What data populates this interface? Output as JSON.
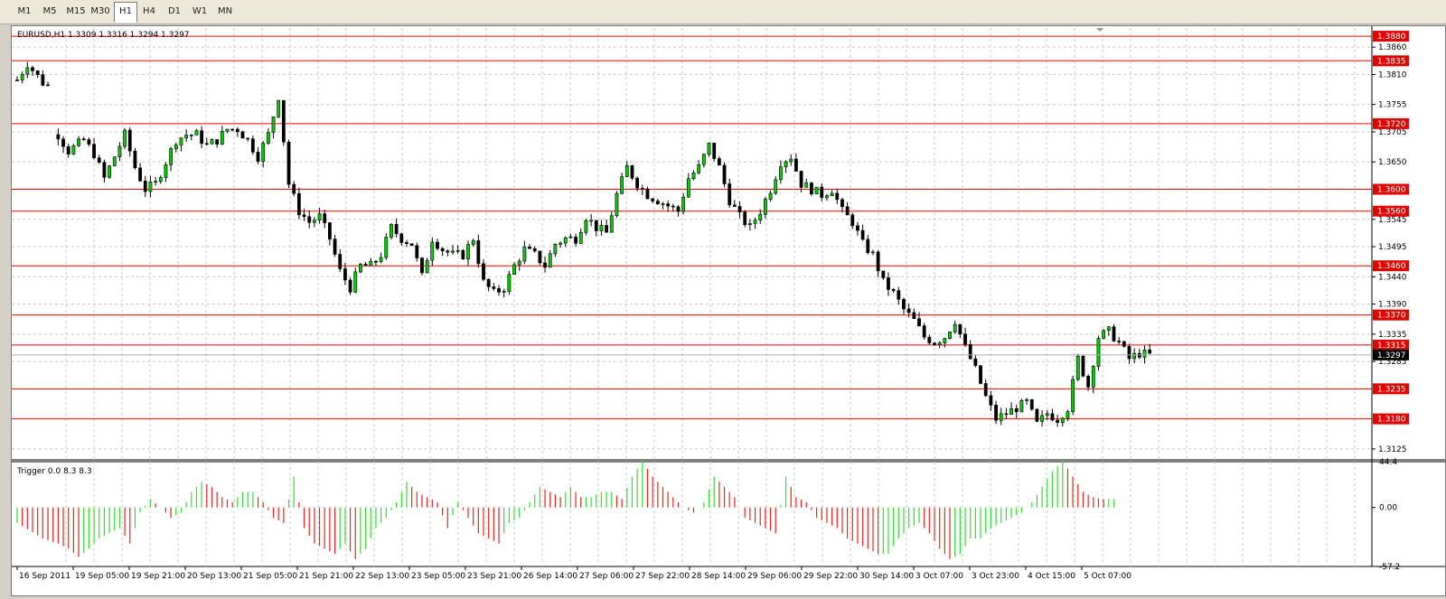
{
  "timeframes": [
    {
      "label": "M1",
      "active": false
    },
    {
      "label": "M5",
      "active": false
    },
    {
      "label": "M15",
      "active": false
    },
    {
      "label": "M30",
      "active": false
    },
    {
      "label": "H1",
      "active": true
    },
    {
      "label": "H4",
      "active": false
    },
    {
      "label": "D1",
      "active": false
    },
    {
      "label": "W1",
      "active": false
    },
    {
      "label": "MN",
      "active": false
    }
  ],
  "chart_header": "EURUSD,H1  1.3309 1.3316 1.3294 1.3297",
  "indicator_header": "Trigger 0.0 8.3 8.3",
  "colors": {
    "line": "#ff0000",
    "candle_bull": "#00cc00",
    "candle_bear": "#000000",
    "hist_pos": "#33dd33",
    "hist_neg": "#ee2222",
    "grid": "#c8c8c8",
    "price_tag_bg": "#e00000",
    "current_tag_bg": "#000000"
  },
  "chart_data": [
    {
      "type": "candlestick",
      "symbol": "EURUSD",
      "timeframe": "H1",
      "ohlc_last": {
        "open": 1.3309,
        "high": 1.3316,
        "low": 1.3294,
        "close": 1.3297
      },
      "y_ticks": [
        "1.3860",
        "1.3810",
        "1.3755",
        "1.3705",
        "1.3650",
        "1.3545",
        "1.3495",
        "1.3440",
        "1.3390",
        "1.3335",
        "1.3285",
        "1.3125"
      ],
      "ylim": [
        1.3105,
        1.3895
      ],
      "horizontal_levels": [
        "1.3880",
        "1.3835",
        "1.3720",
        "1.3600",
        "1.3560",
        "1.3460",
        "1.3370",
        "1.3315",
        "1.3235",
        "1.3180"
      ],
      "current_price": "1.3297",
      "x_labels": [
        "16 Sep 2011",
        "19 Sep 05:00",
        "19 Sep 21:00",
        "20 Sep 13:00",
        "21 Sep 05:00",
        "21 Sep 21:00",
        "22 Sep 13:00",
        "23 Sep 05:00",
        "23 Sep 21:00",
        "26 Sep 14:00",
        "27 Sep 06:00",
        "27 Sep 22:00",
        "28 Sep 14:00",
        "29 Sep 06:00",
        "29 Sep 22:00",
        "30 Sep 14:00",
        "3 Oct 07:00",
        "3 Oct 23:00",
        "4 Oct 15:00",
        "5 Oct 07:00"
      ],
      "close_path": [
        [
          0,
          1.38
        ],
        [
          2,
          1.383
        ],
        [
          5,
          1.3795
        ],
        [
          6,
          1.379
        ],
        [
          8,
          1.37
        ],
        [
          10,
          1.367
        ],
        [
          13,
          1.369
        ],
        [
          15,
          1.3665
        ],
        [
          17,
          1.362
        ],
        [
          19,
          1.366
        ],
        [
          21,
          1.37
        ],
        [
          23,
          1.364
        ],
        [
          25,
          1.36
        ],
        [
          27,
          1.361
        ],
        [
          29,
          1.365
        ],
        [
          31,
          1.369
        ],
        [
          33,
          1.37
        ],
        [
          35,
          1.37
        ],
        [
          37,
          1.368
        ],
        [
          39,
          1.369
        ],
        [
          41,
          1.371
        ],
        [
          43,
          1.371
        ],
        [
          45,
          1.369
        ],
        [
          47,
          1.366
        ],
        [
          49,
          1.37
        ],
        [
          51,
          1.377
        ],
        [
          53,
          1.361
        ],
        [
          55,
          1.356
        ],
        [
          57,
          1.354
        ],
        [
          59,
          1.355
        ],
        [
          61,
          1.351
        ],
        [
          63,
          1.345
        ],
        [
          65,
          1.342
        ],
        [
          67,
          1.346
        ],
        [
          69,
          1.346
        ],
        [
          71,
          1.348
        ],
        [
          73,
          1.353
        ],
        [
          75,
          1.351
        ],
        [
          77,
          1.35
        ],
        [
          79,
          1.344
        ],
        [
          81,
          1.351
        ],
        [
          83,
          1.349
        ],
        [
          85,
          1.348
        ],
        [
          87,
          1.348
        ],
        [
          89,
          1.351
        ],
        [
          91,
          1.343
        ],
        [
          93,
          1.341
        ],
        [
          95,
          1.342
        ],
        [
          97,
          1.346
        ],
        [
          99,
          1.349
        ],
        [
          101,
          1.348
        ],
        [
          103,
          1.346
        ],
        [
          105,
          1.35
        ],
        [
          107,
          1.351
        ],
        [
          109,
          1.351
        ],
        [
          111,
          1.355
        ],
        [
          113,
          1.353
        ],
        [
          115,
          1.352
        ],
        [
          117,
          1.359
        ],
        [
          119,
          1.364
        ],
        [
          121,
          1.361
        ],
        [
          123,
          1.359
        ],
        [
          125,
          1.358
        ],
        [
          127,
          1.357
        ],
        [
          129,
          1.356
        ],
        [
          131,
          1.362
        ],
        [
          133,
          1.364
        ],
        [
          135,
          1.368
        ],
        [
          137,
          1.364
        ],
        [
          139,
          1.358
        ],
        [
          141,
          1.355
        ],
        [
          143,
          1.353
        ],
        [
          145,
          1.356
        ],
        [
          147,
          1.36
        ],
        [
          149,
          1.365
        ],
        [
          151,
          1.366
        ],
        [
          153,
          1.361
        ],
        [
          155,
          1.36
        ],
        [
          157,
          1.359
        ],
        [
          159,
          1.36
        ],
        [
          161,
          1.356
        ],
        [
          163,
          1.354
        ],
        [
          165,
          1.35
        ],
        [
          167,
          1.348
        ],
        [
          169,
          1.343
        ],
        [
          171,
          1.341
        ],
        [
          173,
          1.338
        ],
        [
          175,
          1.336
        ],
        [
          177,
          1.333
        ],
        [
          179,
          1.332
        ],
        [
          181,
          1.333
        ],
        [
          183,
          1.336
        ],
        [
          185,
          1.331
        ],
        [
          187,
          1.327
        ],
        [
          189,
          1.322
        ],
        [
          191,
          1.318
        ],
        [
          193,
          1.319
        ],
        [
          195,
          1.32
        ],
        [
          197,
          1.321
        ],
        [
          199,
          1.317
        ],
        [
          201,
          1.319
        ],
        [
          203,
          1.318
        ],
        [
          205,
          1.32
        ],
        [
          207,
          1.329
        ],
        [
          209,
          1.324
        ],
        [
          211,
          1.333
        ],
        [
          213,
          1.334
        ],
        [
          215,
          1.332
        ],
        [
          217,
          1.329
        ],
        [
          219,
          1.33
        ],
        [
          221,
          1.3297
        ]
      ],
      "n_candles": 224
    },
    {
      "type": "histogram",
      "name": "Trigger",
      "header": "Trigger 0.0 8.3 8.3",
      "y_ticks": [
        "44.4",
        "0.00",
        "-57.2"
      ],
      "ylim": [
        -57.2,
        44.4
      ],
      "envelope": [
        [
          0,
          -15
        ],
        [
          5,
          -30
        ],
        [
          8,
          -35
        ],
        [
          10,
          -40
        ],
        [
          12,
          -48
        ],
        [
          14,
          -40
        ],
        [
          16,
          -30
        ],
        [
          18,
          -25
        ],
        [
          20,
          -20
        ],
        [
          22,
          -35
        ],
        [
          24,
          -5
        ],
        [
          26,
          8
        ],
        [
          28,
          0
        ],
        [
          30,
          -10
        ],
        [
          32,
          -5
        ],
        [
          34,
          15
        ],
        [
          36,
          25
        ],
        [
          38,
          20
        ],
        [
          40,
          10
        ],
        [
          42,
          5
        ],
        [
          44,
          15
        ],
        [
          46,
          15
        ],
        [
          48,
          5
        ],
        [
          50,
          -10
        ],
        [
          52,
          -15
        ],
        [
          54,
          30
        ],
        [
          56,
          -20
        ],
        [
          58,
          -35
        ],
        [
          60,
          -40
        ],
        [
          62,
          -45
        ],
        [
          64,
          -35
        ],
        [
          66,
          -50
        ],
        [
          68,
          -40
        ],
        [
          70,
          -20
        ],
        [
          72,
          -10
        ],
        [
          74,
          5
        ],
        [
          76,
          25
        ],
        [
          78,
          15
        ],
        [
          80,
          10
        ],
        [
          82,
          5
        ],
        [
          84,
          -20
        ],
        [
          86,
          5
        ],
        [
          88,
          -10
        ],
        [
          90,
          -25
        ],
        [
          92,
          -30
        ],
        [
          94,
          -35
        ],
        [
          96,
          -15
        ],
        [
          98,
          -10
        ],
        [
          100,
          5
        ],
        [
          102,
          20
        ],
        [
          104,
          15
        ],
        [
          106,
          10
        ],
        [
          108,
          20
        ],
        [
          110,
          10
        ],
        [
          112,
          10
        ],
        [
          114,
          15
        ],
        [
          116,
          15
        ],
        [
          118,
          8
        ],
        [
          120,
          30
        ],
        [
          122,
          45
        ],
        [
          124,
          30
        ],
        [
          126,
          20
        ],
        [
          128,
          10
        ],
        [
          130,
          0
        ],
        [
          132,
          -5
        ],
        [
          134,
          5
        ],
        [
          136,
          30
        ],
        [
          138,
          20
        ],
        [
          140,
          10
        ],
        [
          142,
          -10
        ],
        [
          144,
          -15
        ],
        [
          146,
          -20
        ],
        [
          148,
          -25
        ],
        [
          150,
          30
        ],
        [
          152,
          10
        ],
        [
          154,
          5
        ],
        [
          156,
          -10
        ],
        [
          158,
          -15
        ],
        [
          160,
          -20
        ],
        [
          162,
          -30
        ],
        [
          164,
          -35
        ],
        [
          166,
          -40
        ],
        [
          168,
          -45
        ],
        [
          170,
          -45
        ],
        [
          172,
          -30
        ],
        [
          174,
          -20
        ],
        [
          176,
          -15
        ],
        [
          178,
          -25
        ],
        [
          180,
          -40
        ],
        [
          182,
          -50
        ],
        [
          184,
          -45
        ],
        [
          186,
          -30
        ],
        [
          188,
          -30
        ],
        [
          190,
          -20
        ],
        [
          192,
          -15
        ],
        [
          194,
          -10
        ],
        [
          196,
          -5
        ],
        [
          198,
          5
        ],
        [
          200,
          20
        ],
        [
          202,
          35
        ],
        [
          204,
          45
        ],
        [
          206,
          30
        ],
        [
          208,
          15
        ],
        [
          210,
          10
        ],
        [
          212,
          8
        ],
        [
          214,
          8
        ]
      ]
    }
  ]
}
